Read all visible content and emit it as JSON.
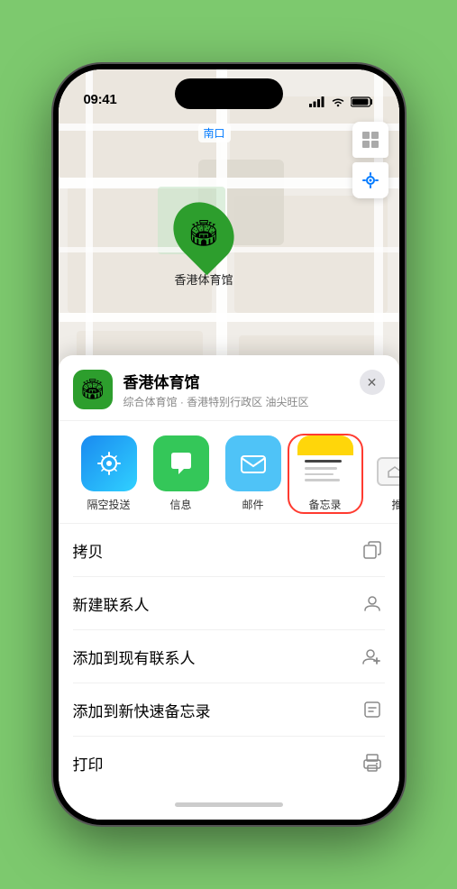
{
  "status_bar": {
    "time": "09:41",
    "location_arrow": "▶"
  },
  "map": {
    "north_label": "南口",
    "location_name": "香港体育馆"
  },
  "sheet": {
    "venue_name": "香港体育馆",
    "venue_sub": "综合体育馆 · 香港特别行政区 油尖旺区",
    "close_label": "✕"
  },
  "share_items": [
    {
      "id": "airdrop",
      "label": "隔空投送",
      "type": "airdrop"
    },
    {
      "id": "messages",
      "label": "信息",
      "type": "messages"
    },
    {
      "id": "mail",
      "label": "邮件",
      "type": "mail"
    },
    {
      "id": "notes",
      "label": "备忘录",
      "type": "notes"
    },
    {
      "id": "more",
      "label": "推",
      "type": "more"
    }
  ],
  "actions": [
    {
      "label": "拷贝",
      "icon": "copy"
    },
    {
      "label": "新建联系人",
      "icon": "person"
    },
    {
      "label": "添加到现有联系人",
      "icon": "person-add"
    },
    {
      "label": "添加到新快速备忘录",
      "icon": "note"
    },
    {
      "label": "打印",
      "icon": "print"
    }
  ]
}
